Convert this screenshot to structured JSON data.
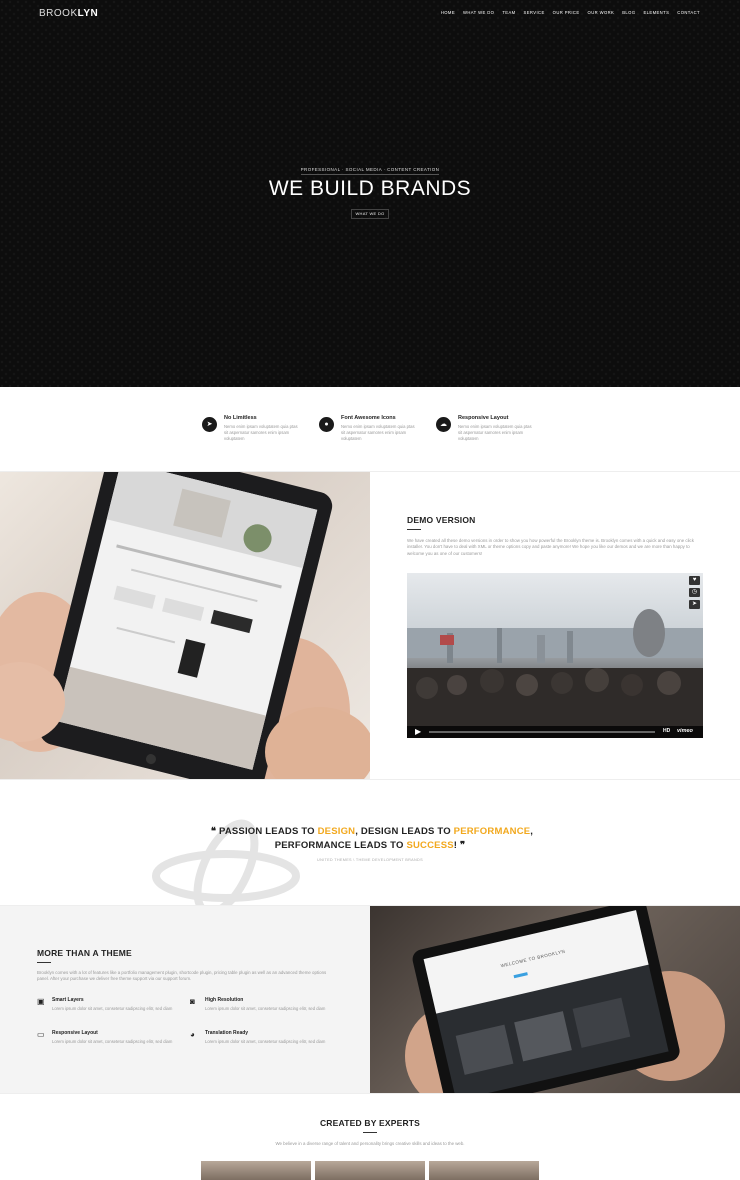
{
  "brand": {
    "logo_thin": "BROOK",
    "logo_bold": "LYN"
  },
  "nav": [
    "HOME",
    "WHAT WE DO",
    "TEAM",
    "SERVICE",
    "OUR PRICE",
    "OUR WORK",
    "BLOG",
    "ELEMENTS",
    "CONTACT"
  ],
  "hero": {
    "kicker": "PROFESSIONAL · SOCIAL MEDIA · CONTENT CREATION",
    "title": "WE BUILD BRANDS",
    "button": "WHAT WE DO"
  },
  "features": [
    {
      "icon": "paper-plane-icon",
      "glyph": "➤",
      "title": "No Limitless",
      "text": "Nemo enim ipsam voluptatem quia ptas sit aspernatur samores enim ipsam voluptatem"
    },
    {
      "icon": "lightbulb-icon",
      "glyph": "●",
      "title": "Font Awesome Icons",
      "text": "Nemo enim ipsam voluptatem quia ptas sit aspernatur samores enim ipsam voluptatem"
    },
    {
      "icon": "cloud-icon",
      "glyph": "☁",
      "title": "Responsive Layout",
      "text": "Nemo enim ipsam voluptatem quia ptas sit aspernatur samores enim ipsam voluptatem"
    }
  ],
  "demo": {
    "title": "DEMO VERSION",
    "text": "We have created all these demo versions in order to show you how powerful the Brooklyn theme is. Brooklyn comes with a quick and easy one click installer. You don't have to deal with XML or theme options copy and paste anymore! We hope you like our demos and we are more than happy to welcome you as one of our customers!",
    "video_brand": "vimeo",
    "video_hd": "HD"
  },
  "quote": {
    "p1": "PASSION LEADS TO ",
    "w1": "DESIGN",
    "p2": ", DESIGN LEADS TO ",
    "w2": "PERFORMANCE",
    "p3": ",",
    "p4": "PERFORMANCE LEADS TO ",
    "w3": "SUCCESS",
    "p5": "!",
    "author": "UNITED THEMES \\ THEME DEVELOPMENT BRANDS"
  },
  "more": {
    "title": "MORE THAN A THEME",
    "text": "Brooklyn comes with a lot of features like a portfolio management plugin, shortcode plugin, pricing table plugin as well as an advanced theme options panel. After your purchase we deliver free theme support via our support forum.",
    "features": [
      {
        "icon": "image-icon",
        "glyph": "▣",
        "title": "Smart Layers",
        "text": "Lorem ipsum dolor sit amet, consetetur sadipscing elitr, sed diam"
      },
      {
        "icon": "camera-icon",
        "glyph": "◙",
        "title": "High Resolution",
        "text": "Lorem ipsum dolor sit amet, consetetur sadipscing elitr, sed diam"
      },
      {
        "icon": "desktop-icon",
        "glyph": "▭",
        "title": "Responsive Layout",
        "text": "Lorem ipsum dolor sit amet, consetetur sadipscing elitr, sed diam"
      },
      {
        "icon": "globe-icon",
        "glyph": "◕",
        "title": "Translation Ready",
        "text": "Lorem ipsum dolor sit amet, consetetur sadipscing elitr, sed diam"
      }
    ],
    "tablet_heading": "WELCOME TO BROOKLYN"
  },
  "experts": {
    "title": "CREATED BY EXPERTS",
    "text": "We believe in a diverse range of talent and personality brings creative skills and ideas to the web."
  }
}
